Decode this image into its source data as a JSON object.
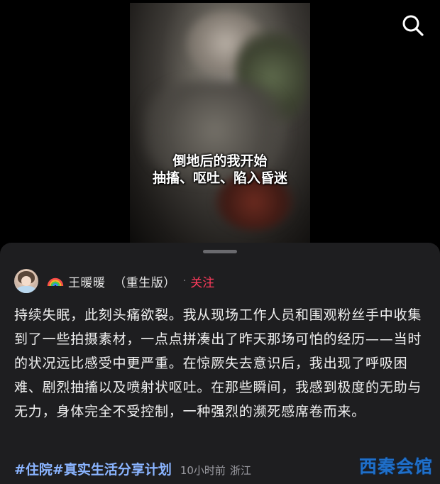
{
  "video": {
    "caption_line1": "倒地后的我开始",
    "caption_line2": "抽搐、呕吐、陷入昏迷"
  },
  "post": {
    "author_name": "王暖暖  （重生版）",
    "author_prefix_icon": "rainbow-icon",
    "follow_label": "关注",
    "separator": "·",
    "body": "持续失眠，此刻头痛欲裂。我从现场工作人员和围观粉丝手中收集到了一些拍摄素材，一点点拼凑出了昨天那场可怕的经历——当时的状况远比感受中更严重。在惊厥失去意识后，我出现了呼吸困难、剧烈抽搐以及喷射状呕吐。在那些瞬间，我感到极度的无助与无力，身体完全不受控制，一种强烈的濒死感席卷而来。",
    "hashtags": [
      "#住院",
      "#真实生活分享计划"
    ],
    "time": "10小时前",
    "location": "浙江"
  },
  "watermark": "西秦会馆",
  "colors": {
    "follow": "#ff3b5c",
    "hashtag": "#8ab4ff",
    "sheet_bg": "#1e1e20",
    "watermark": "#1f6fc9"
  }
}
